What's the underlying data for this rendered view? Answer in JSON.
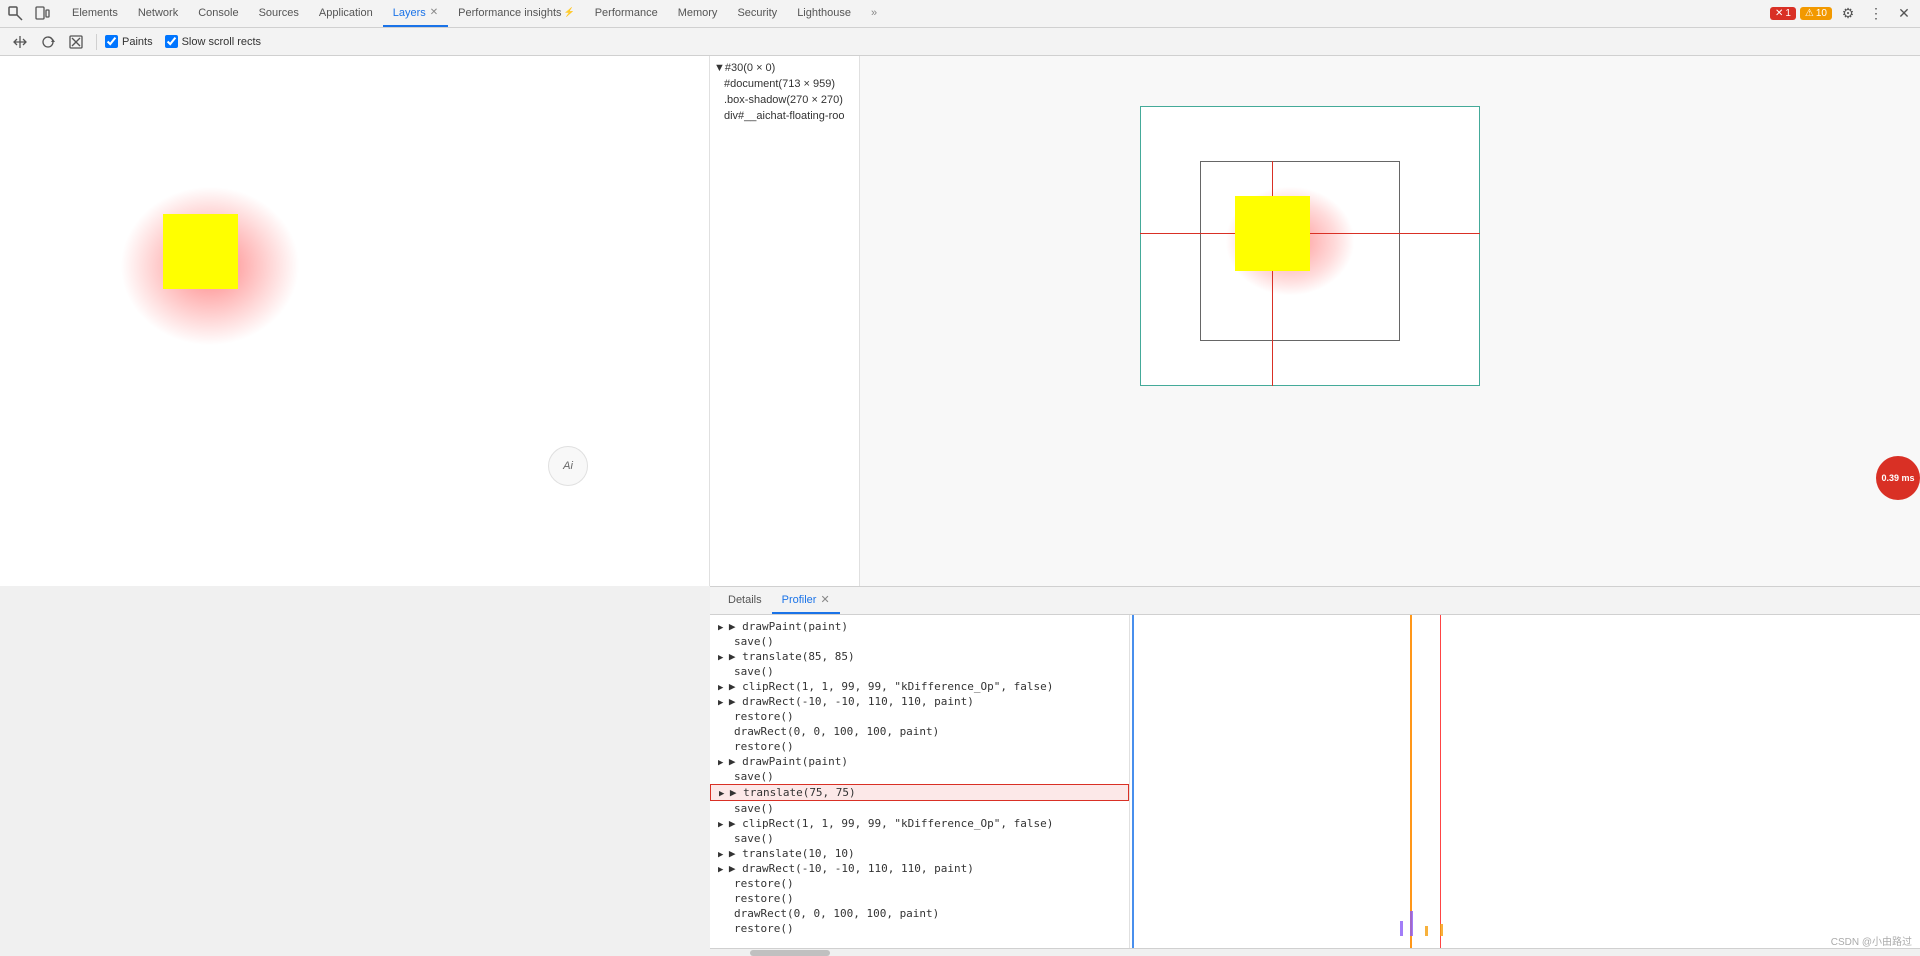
{
  "toolbar": {
    "tabs": [
      {
        "label": "Elements",
        "active": false,
        "id": "elements"
      },
      {
        "label": "Network",
        "active": false,
        "id": "network"
      },
      {
        "label": "Console",
        "active": false,
        "id": "console"
      },
      {
        "label": "Sources",
        "active": false,
        "id": "sources"
      },
      {
        "label": "Application",
        "active": false,
        "id": "application"
      },
      {
        "label": "Layers",
        "active": true,
        "id": "layers"
      },
      {
        "label": "Performance insights",
        "active": false,
        "id": "performance-insights"
      },
      {
        "label": "Performance",
        "active": false,
        "id": "performance"
      },
      {
        "label": "Memory",
        "active": false,
        "id": "memory"
      },
      {
        "label": "Security",
        "active": false,
        "id": "security"
      },
      {
        "label": "Lighthouse",
        "active": false,
        "id": "lighthouse"
      }
    ],
    "error_count": "1",
    "warning_count": "10"
  },
  "layers_toolbar": {
    "paints_label": "Paints",
    "slow_scroll_rects_label": "Slow scroll rects",
    "paints_checked": true,
    "slow_scroll_rects_checked": true
  },
  "tree": {
    "items": [
      {
        "label": "▼#30(0 × 0)",
        "indent": 0,
        "selected": false
      },
      {
        "label": "#document(713 × 959)",
        "indent": 1,
        "selected": false
      },
      {
        "label": ".box-shadow(270 × 270)",
        "indent": 1,
        "selected": false
      },
      {
        "label": "div#__aichat-floating-roo",
        "indent": 1,
        "selected": false
      }
    ]
  },
  "bottom_panel": {
    "tabs": [
      {
        "label": "Details",
        "active": false,
        "id": "details"
      },
      {
        "label": "Profiler",
        "active": true,
        "id": "profiler"
      }
    ]
  },
  "profiler": {
    "items": [
      {
        "label": "▶ drawPaint(paint)",
        "expandable": true,
        "indent": 0,
        "highlighted": false
      },
      {
        "label": "save()",
        "expandable": false,
        "indent": 1,
        "highlighted": false
      },
      {
        "label": "▶ translate(85, 85)",
        "expandable": true,
        "indent": 0,
        "highlighted": false
      },
      {
        "label": "save()",
        "expandable": false,
        "indent": 1,
        "highlighted": false
      },
      {
        "label": "▶ clipRect(1, 1, 99, 99, \"kDifference_Op\", false)",
        "expandable": true,
        "indent": 0,
        "highlighted": false
      },
      {
        "label": "▶ drawRect(-10, -10, 110, 110, paint)",
        "expandable": true,
        "indent": 0,
        "highlighted": false
      },
      {
        "label": "restore()",
        "expandable": false,
        "indent": 1,
        "highlighted": false
      },
      {
        "label": "drawRect(0, 0, 100, 100, paint)",
        "expandable": false,
        "indent": 1,
        "highlighted": false
      },
      {
        "label": "restore()",
        "expandable": false,
        "indent": 1,
        "highlighted": false
      },
      {
        "label": "▶ drawPaint(paint)",
        "expandable": true,
        "indent": 0,
        "highlighted": false
      },
      {
        "label": "save()",
        "expandable": false,
        "indent": 1,
        "highlighted": false
      },
      {
        "label": "▶ translate(75, 75)",
        "expandable": true,
        "indent": 0,
        "highlighted": true
      },
      {
        "label": "save()",
        "expandable": false,
        "indent": 1,
        "highlighted": false
      },
      {
        "label": "▶ clipRect(1, 1, 99, 99, \"kDifference_Op\", false)",
        "expandable": true,
        "indent": 0,
        "highlighted": false
      },
      {
        "label": "save()",
        "expandable": false,
        "indent": 1,
        "highlighted": false
      },
      {
        "label": "▶ translate(10, 10)",
        "expandable": true,
        "indent": 0,
        "highlighted": false
      },
      {
        "label": "▶ drawRect(-10, -10, 110, 110, paint)",
        "expandable": true,
        "indent": 0,
        "highlighted": false
      },
      {
        "label": "restore()",
        "expandable": false,
        "indent": 1,
        "highlighted": false
      },
      {
        "label": "restore()",
        "expandable": false,
        "indent": 1,
        "highlighted": false
      },
      {
        "label": "drawRect(0, 0, 100, 100, paint)",
        "expandable": false,
        "indent": 1,
        "highlighted": false
      },
      {
        "label": "restore()",
        "expandable": false,
        "indent": 1,
        "highlighted": false
      }
    ]
  },
  "timer": {
    "value": "0.39 ms"
  },
  "watermark": {
    "text": "CSDN @小由路过"
  }
}
